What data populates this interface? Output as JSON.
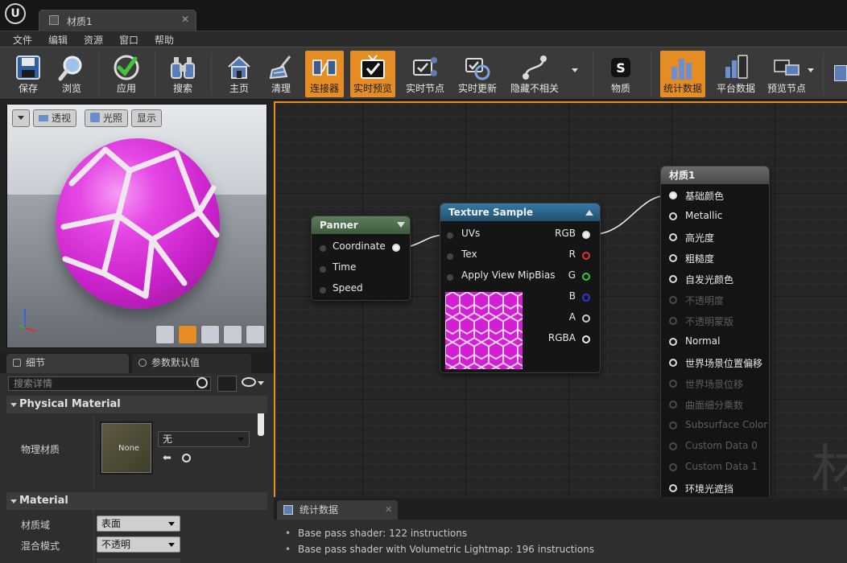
{
  "window": {
    "tab_title": "材质1",
    "logo": "U"
  },
  "menu": [
    "文件",
    "编辑",
    "资源",
    "窗口",
    "帮助"
  ],
  "toolbar": [
    {
      "label": "保存",
      "icon": "save-icon",
      "active": false
    },
    {
      "label": "浏览",
      "icon": "magnifier-icon",
      "active": false
    },
    {
      "label": "应用",
      "icon": "check-icon",
      "active": false
    },
    {
      "label": "搜索",
      "icon": "binoculars-icon",
      "active": false
    },
    {
      "label": "主页",
      "icon": "home-icon",
      "active": false
    },
    {
      "label": "清理",
      "icon": "broom-icon",
      "active": false
    },
    {
      "label": "连接器",
      "icon": "connector-icon",
      "active": true
    },
    {
      "label": "实时预览",
      "icon": "tv-icon",
      "active": true
    },
    {
      "label": "实时节点",
      "icon": "live-nodes-icon",
      "active": false
    },
    {
      "label": "实时更新",
      "icon": "live-update-icon",
      "active": false
    },
    {
      "label": "隐藏不相关",
      "icon": "hide-unrelated-icon",
      "active": false
    },
    {
      "label": "物质",
      "icon": "substance-icon",
      "active": false
    },
    {
      "label": "统计数据",
      "icon": "stats-icon",
      "active": true
    },
    {
      "label": "平台数据",
      "icon": "platform-stats-icon",
      "active": false
    },
    {
      "label": "预览节点",
      "icon": "preview-node-icon",
      "active": false
    }
  ],
  "viewport": {
    "buttons": {
      "perspective": "透视",
      "lit": "光照",
      "show": "显示"
    }
  },
  "details": {
    "tab_details": "细节",
    "tab_params": "参数默认值",
    "search_placeholder": "搜索详情",
    "cat_physical": "Physical Material",
    "prop_phys_mat": "物理材质",
    "thumb_none": "None",
    "phys_mat_value": "无",
    "cat_material": "Material",
    "prop_domain": "材质域",
    "prop_domain_value": "表面",
    "prop_blend": "混合模式",
    "prop_blend_value": "不透明"
  },
  "nodes": {
    "panner": {
      "title": "Panner",
      "inputs": [
        "Coordinate",
        "Time",
        "Speed"
      ]
    },
    "texture": {
      "title": "Texture Sample",
      "inputs": [
        "UVs",
        "Tex",
        "Apply View MipBias"
      ],
      "outputs": [
        "RGB",
        "R",
        "G",
        "B",
        "A",
        "RGBA"
      ]
    },
    "material": {
      "title": "材质1",
      "pins": [
        {
          "label": "基础颜色",
          "enabled": true,
          "connected": true
        },
        {
          "label": "Metallic",
          "enabled": true
        },
        {
          "label": "高光度",
          "enabled": true
        },
        {
          "label": "粗糙度",
          "enabled": true
        },
        {
          "label": "自发光颜色",
          "enabled": true
        },
        {
          "label": "不透明度",
          "enabled": false
        },
        {
          "label": "不透明蒙版",
          "enabled": false
        },
        {
          "label": "Normal",
          "enabled": true
        },
        {
          "label": "世界场景位置偏移",
          "enabled": true
        },
        {
          "label": "世界场景位移",
          "enabled": false
        },
        {
          "label": "曲面细分乘数",
          "enabled": false
        },
        {
          "label": "Subsurface Color",
          "enabled": false
        },
        {
          "label": "Custom Data 0",
          "enabled": false
        },
        {
          "label": "Custom Data 1",
          "enabled": false
        },
        {
          "label": "环境光遮挡",
          "enabled": true
        }
      ]
    }
  },
  "graph": {
    "watermark": "材"
  },
  "stats": {
    "tab": "统计数据",
    "lines": [
      "Base pass shader: 122 instructions",
      "Base pass shader with Volumetric Lightmap: 196 instructions"
    ]
  },
  "colors": {
    "accent": "#e58c23",
    "sphere": "#d22fd3",
    "panner_header": "#4e6b4e",
    "texture_header": "#2b5d80",
    "material_header": "#5a5a5a"
  }
}
